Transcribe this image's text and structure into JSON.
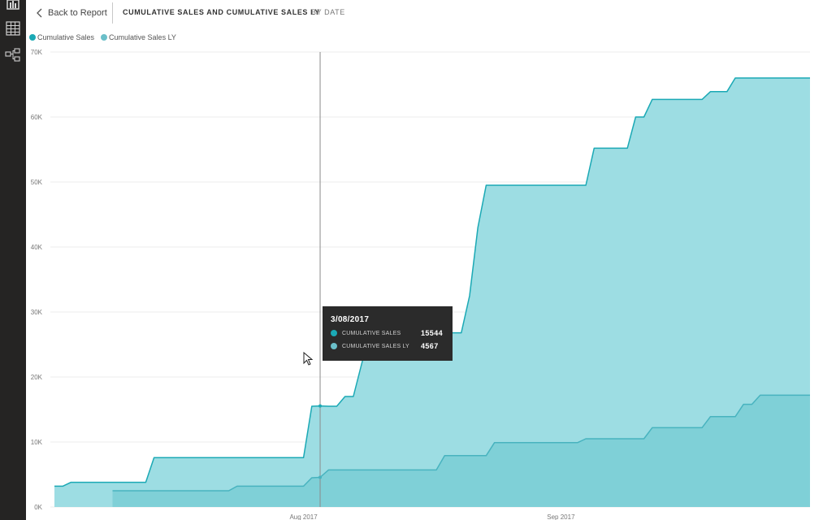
{
  "header": {
    "back_label": "Back to Report",
    "title": "CUMULATIVE SALES AND CUMULATIVE SALES LY",
    "subtitle": "BY DATE"
  },
  "nav_icons": [
    "bar-chart-icon",
    "table-icon",
    "hierarchy-icon"
  ],
  "tooltip": {
    "date": "3/08/2017",
    "rows": [
      {
        "label": "CUMULATIVE SALES",
        "value": "15544",
        "color": "#1ba9b5"
      },
      {
        "label": "CUMULATIVE SALES LY",
        "value": "4567",
        "color": "#6bbfc9"
      }
    ]
  },
  "chart_data": {
    "type": "area",
    "y_ticks": [
      "0K",
      "10K",
      "20K",
      "30K",
      "40K",
      "50K",
      "60K",
      "70K"
    ],
    "ylim": [
      0,
      70000
    ],
    "x_ticks": [
      {
        "label": "Aug 2017",
        "day": 31
      },
      {
        "label": "Sep 2017",
        "day": 62
      }
    ],
    "grid": "horizontal",
    "legend_position": "top-left",
    "hover_day": 33,
    "series": [
      {
        "name": "Cumulative Sales",
        "line_color": "#1ba9b5",
        "fill_color": "#9ddde3",
        "points": [
          [
            1,
            3200
          ],
          [
            2,
            3200
          ],
          [
            3,
            3800
          ],
          [
            4,
            3800
          ],
          [
            5,
            3800
          ],
          [
            6,
            3800
          ],
          [
            7,
            3800
          ],
          [
            8,
            3800
          ],
          [
            9,
            3800
          ],
          [
            10,
            3800
          ],
          [
            11,
            3800
          ],
          [
            12,
            3800
          ],
          [
            13,
            7600
          ],
          [
            14,
            7600
          ],
          [
            15,
            7600
          ],
          [
            16,
            7600
          ],
          [
            17,
            7600
          ],
          [
            18,
            7600
          ],
          [
            19,
            7600
          ],
          [
            20,
            7600
          ],
          [
            21,
            7600
          ],
          [
            22,
            7600
          ],
          [
            23,
            7600
          ],
          [
            24,
            7600
          ],
          [
            25,
            7600
          ],
          [
            26,
            7600
          ],
          [
            27,
            7600
          ],
          [
            28,
            7600
          ],
          [
            29,
            7600
          ],
          [
            30,
            7600
          ],
          [
            31,
            7600
          ],
          [
            32,
            15500
          ],
          [
            33,
            15544
          ],
          [
            34,
            15500
          ],
          [
            35,
            15500
          ],
          [
            36,
            17000
          ],
          [
            37,
            17000
          ],
          [
            38,
            22000
          ],
          [
            39,
            26800
          ],
          [
            40,
            26800
          ],
          [
            41,
            26800
          ],
          [
            42,
            26800
          ],
          [
            43,
            26800
          ],
          [
            44,
            26800
          ],
          [
            45,
            26800
          ],
          [
            46,
            26800
          ],
          [
            47,
            26800
          ],
          [
            48,
            26800
          ],
          [
            49,
            26800
          ],
          [
            50,
            26800
          ],
          [
            51,
            32500
          ],
          [
            52,
            43000
          ],
          [
            53,
            49500
          ],
          [
            54,
            49500
          ],
          [
            55,
            49500
          ],
          [
            56,
            49500
          ],
          [
            57,
            49500
          ],
          [
            58,
            49500
          ],
          [
            59,
            49500
          ],
          [
            60,
            49500
          ],
          [
            61,
            49500
          ],
          [
            62,
            49500
          ],
          [
            63,
            49500
          ],
          [
            64,
            49500
          ],
          [
            65,
            49500
          ],
          [
            66,
            55200
          ],
          [
            67,
            55200
          ],
          [
            68,
            55200
          ],
          [
            69,
            55200
          ],
          [
            70,
            55200
          ],
          [
            71,
            60000
          ],
          [
            72,
            60000
          ],
          [
            73,
            62700
          ],
          [
            74,
            62700
          ],
          [
            75,
            62700
          ],
          [
            76,
            62700
          ],
          [
            77,
            62700
          ],
          [
            78,
            62700
          ],
          [
            79,
            62700
          ],
          [
            80,
            63900
          ],
          [
            81,
            63900
          ],
          [
            82,
            63900
          ],
          [
            83,
            66000
          ],
          [
            84,
            66000
          ],
          [
            85,
            66000
          ],
          [
            86,
            66000
          ],
          [
            87,
            66000
          ],
          [
            88,
            66000
          ],
          [
            89,
            66000
          ],
          [
            90,
            66000
          ],
          [
            91,
            66000
          ],
          [
            92,
            66000
          ]
        ]
      },
      {
        "name": "Cumulative Sales LY",
        "line_color": "#48b3bf",
        "fill_color": "#7fd0d7",
        "points": [
          [
            8,
            2500
          ],
          [
            9,
            2500
          ],
          [
            10,
            2500
          ],
          [
            11,
            2500
          ],
          [
            12,
            2500
          ],
          [
            13,
            2500
          ],
          [
            14,
            2500
          ],
          [
            15,
            2500
          ],
          [
            16,
            2500
          ],
          [
            17,
            2500
          ],
          [
            18,
            2500
          ],
          [
            19,
            2500
          ],
          [
            20,
            2500
          ],
          [
            21,
            2500
          ],
          [
            22,
            2500
          ],
          [
            23,
            3200
          ],
          [
            24,
            3200
          ],
          [
            25,
            3200
          ],
          [
            26,
            3200
          ],
          [
            27,
            3200
          ],
          [
            28,
            3200
          ],
          [
            29,
            3200
          ],
          [
            30,
            3200
          ],
          [
            31,
            3200
          ],
          [
            32,
            4500
          ],
          [
            33,
            4567
          ],
          [
            34,
            5700
          ],
          [
            35,
            5700
          ],
          [
            36,
            5700
          ],
          [
            37,
            5700
          ],
          [
            38,
            5700
          ],
          [
            39,
            5700
          ],
          [
            40,
            5700
          ],
          [
            41,
            5700
          ],
          [
            42,
            5700
          ],
          [
            43,
            5700
          ],
          [
            44,
            5700
          ],
          [
            45,
            5700
          ],
          [
            46,
            5700
          ],
          [
            47,
            5700
          ],
          [
            48,
            7900
          ],
          [
            49,
            7900
          ],
          [
            50,
            7900
          ],
          [
            51,
            7900
          ],
          [
            52,
            7900
          ],
          [
            53,
            7900
          ],
          [
            54,
            9900
          ],
          [
            55,
            9900
          ],
          [
            56,
            9900
          ],
          [
            57,
            9900
          ],
          [
            58,
            9900
          ],
          [
            59,
            9900
          ],
          [
            60,
            9900
          ],
          [
            61,
            9900
          ],
          [
            62,
            9900
          ],
          [
            63,
            9900
          ],
          [
            64,
            9900
          ],
          [
            65,
            10500
          ],
          [
            66,
            10500
          ],
          [
            67,
            10500
          ],
          [
            68,
            10500
          ],
          [
            69,
            10500
          ],
          [
            70,
            10500
          ],
          [
            71,
            10500
          ],
          [
            72,
            10500
          ],
          [
            73,
            12200
          ],
          [
            74,
            12200
          ],
          [
            75,
            12200
          ],
          [
            76,
            12200
          ],
          [
            77,
            12200
          ],
          [
            78,
            12200
          ],
          [
            79,
            12200
          ],
          [
            80,
            13900
          ],
          [
            81,
            13900
          ],
          [
            82,
            13900
          ],
          [
            83,
            13900
          ],
          [
            84,
            15800
          ],
          [
            85,
            15800
          ],
          [
            86,
            17200
          ],
          [
            87,
            17200
          ],
          [
            88,
            17200
          ],
          [
            89,
            17200
          ],
          [
            90,
            17200
          ],
          [
            91,
            17200
          ],
          [
            92,
            17200
          ]
        ]
      }
    ]
  }
}
